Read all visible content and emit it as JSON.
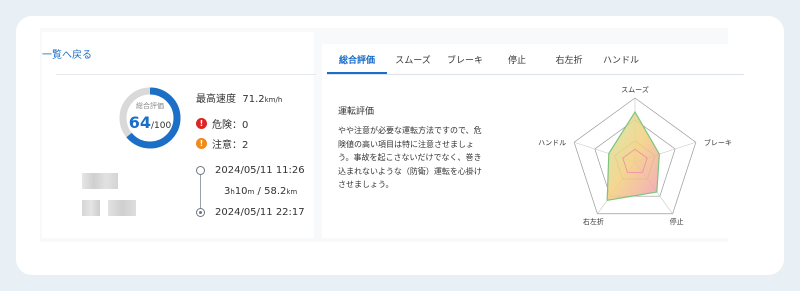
{
  "nav": {
    "back_label": "一覧へ戻る"
  },
  "summary": {
    "score_title": "総合評価",
    "score": "64",
    "score_total": "/100",
    "score_fraction": 0.64,
    "max_speed_label": "最高速度",
    "max_speed_value": "71.2",
    "max_speed_unit": "km/h",
    "danger_label": "危険：0",
    "caution_label": "注意：2",
    "start_time": "2024/05/11 11:26",
    "duration_h": "3",
    "duration_h_unit": "h",
    "duration_m": "10",
    "duration_m_unit": "m",
    "duration_sep": " / ",
    "distance": "58.2",
    "distance_unit": "km",
    "end_time": "2024/05/11 22:17"
  },
  "tabs": [
    {
      "label": "総合評価",
      "active": true
    },
    {
      "label": "スムーズ",
      "active": false
    },
    {
      "label": "ブレーキ",
      "active": false
    },
    {
      "label": "停止",
      "active": false
    },
    {
      "label": "右左折",
      "active": false
    },
    {
      "label": "ハンドル",
      "active": false
    }
  ],
  "evaluation": {
    "title": "運転評価",
    "text": "やや注意が必要な運転方法ですので、危険値の高い項目は特に注意させましょう。事故を起こさないだけでなく、巻き込まれないような（防衛）運転を心掛けさせましょう。"
  },
  "radar": {
    "labels": [
      "スムーズ",
      "ブレーキ",
      "停止",
      "右左折",
      "ハンドル"
    ],
    "values": [
      0.78,
      0.4,
      0.58,
      0.74,
      0.43
    ],
    "colors": {
      "outer": "#7cc47f",
      "inner": "#f08aa8",
      "mid": "#f3d26a"
    }
  },
  "colors": {
    "accent": "#1b6fc6",
    "danger": "#e02424",
    "caution": "#f28a17"
  }
}
